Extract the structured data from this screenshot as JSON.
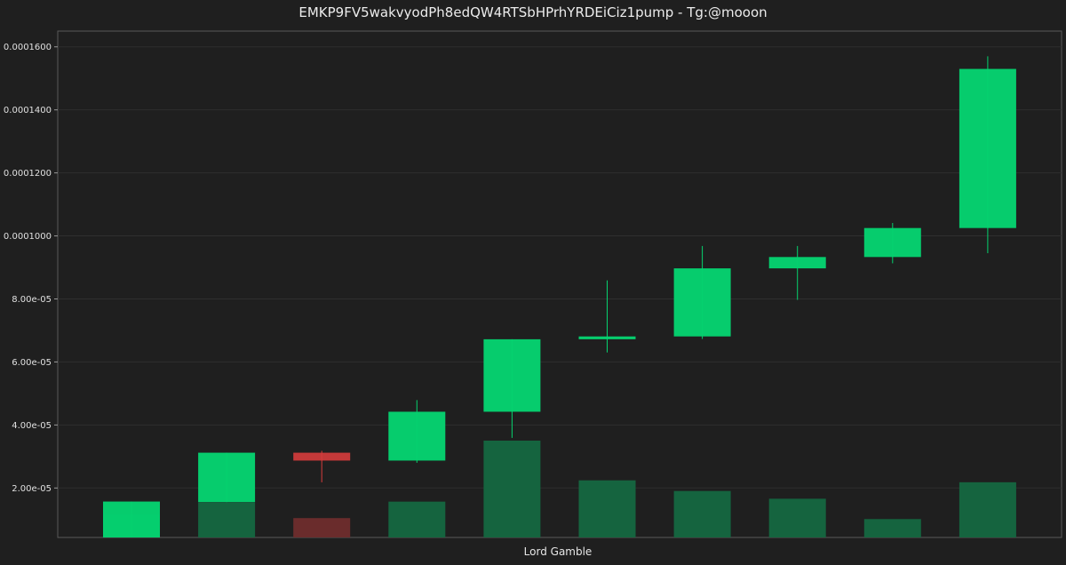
{
  "chart_data": {
    "type": "candlestick",
    "title": "EMKP9FV5wakvyodPh8edQW4RTSbHPrhYRDEiCiz1pump - Tg:@mooon",
    "xlabel": "Lord Gamble",
    "ylabel": "",
    "ylim": [
      4.3e-06,
      0.000165
    ],
    "grid": true,
    "yticks": [
      {
        "value": 2e-05,
        "label": "2.00e-05"
      },
      {
        "value": 4e-05,
        "label": "4.00e-05"
      },
      {
        "value": 6e-05,
        "label": "6.00e-05"
      },
      {
        "value": 8e-05,
        "label": "8.00e-05"
      },
      {
        "value": 0.0001,
        "label": "0.0001000"
      },
      {
        "value": 0.00012,
        "label": "0.0001200"
      },
      {
        "value": 0.00014,
        "label": "0.0001400"
      },
      {
        "value": 0.00016,
        "label": "0.0001600"
      }
    ],
    "candles": [
      {
        "open": 4.3e-06,
        "close": 1.57e-05,
        "high": 1.57e-05,
        "low": 4.3e-06
      },
      {
        "open": 1.55e-05,
        "close": 3.12e-05,
        "high": 3.12e-05,
        "low": 1.55e-05
      },
      {
        "open": 3.12e-05,
        "close": 2.87e-05,
        "high": 3.18e-05,
        "low": 2.18e-05
      },
      {
        "open": 2.87e-05,
        "close": 4.42e-05,
        "high": 4.79e-05,
        "low": 2.8e-05
      },
      {
        "open": 4.42e-05,
        "close": 6.72e-05,
        "high": 6.72e-05,
        "low": 3.59e-05
      },
      {
        "open": 6.72e-05,
        "close": 6.81e-05,
        "high": 8.59e-05,
        "low": 6.3e-05
      },
      {
        "open": 6.81e-05,
        "close": 8.97e-05,
        "high": 9.68e-05,
        "low": 6.73e-05
      },
      {
        "open": 8.97e-05,
        "close": 9.33e-05,
        "high": 9.68e-05,
        "low": 7.97e-05
      },
      {
        "open": 9.33e-05,
        "close": 0.0001025,
        "high": 0.0001041,
        "low": 9.13e-05
      },
      {
        "open": 0.0001025,
        "close": 0.000153,
        "high": 0.000157,
        "low": 9.45e-05
      }
    ],
    "volume_relative": [
      0.24,
      0.36,
      0.2,
      0.37,
      1.0,
      0.59,
      0.48,
      0.4,
      0.19,
      0.57
    ],
    "colors": {
      "up": "#05d26f",
      "down": "#d63c3c",
      "volume_up": "#15643f",
      "volume_down": "#6a2c2c",
      "background": "#1f1f1f",
      "axes": "#5a5a5a",
      "grid": "#2f2f2f"
    }
  }
}
